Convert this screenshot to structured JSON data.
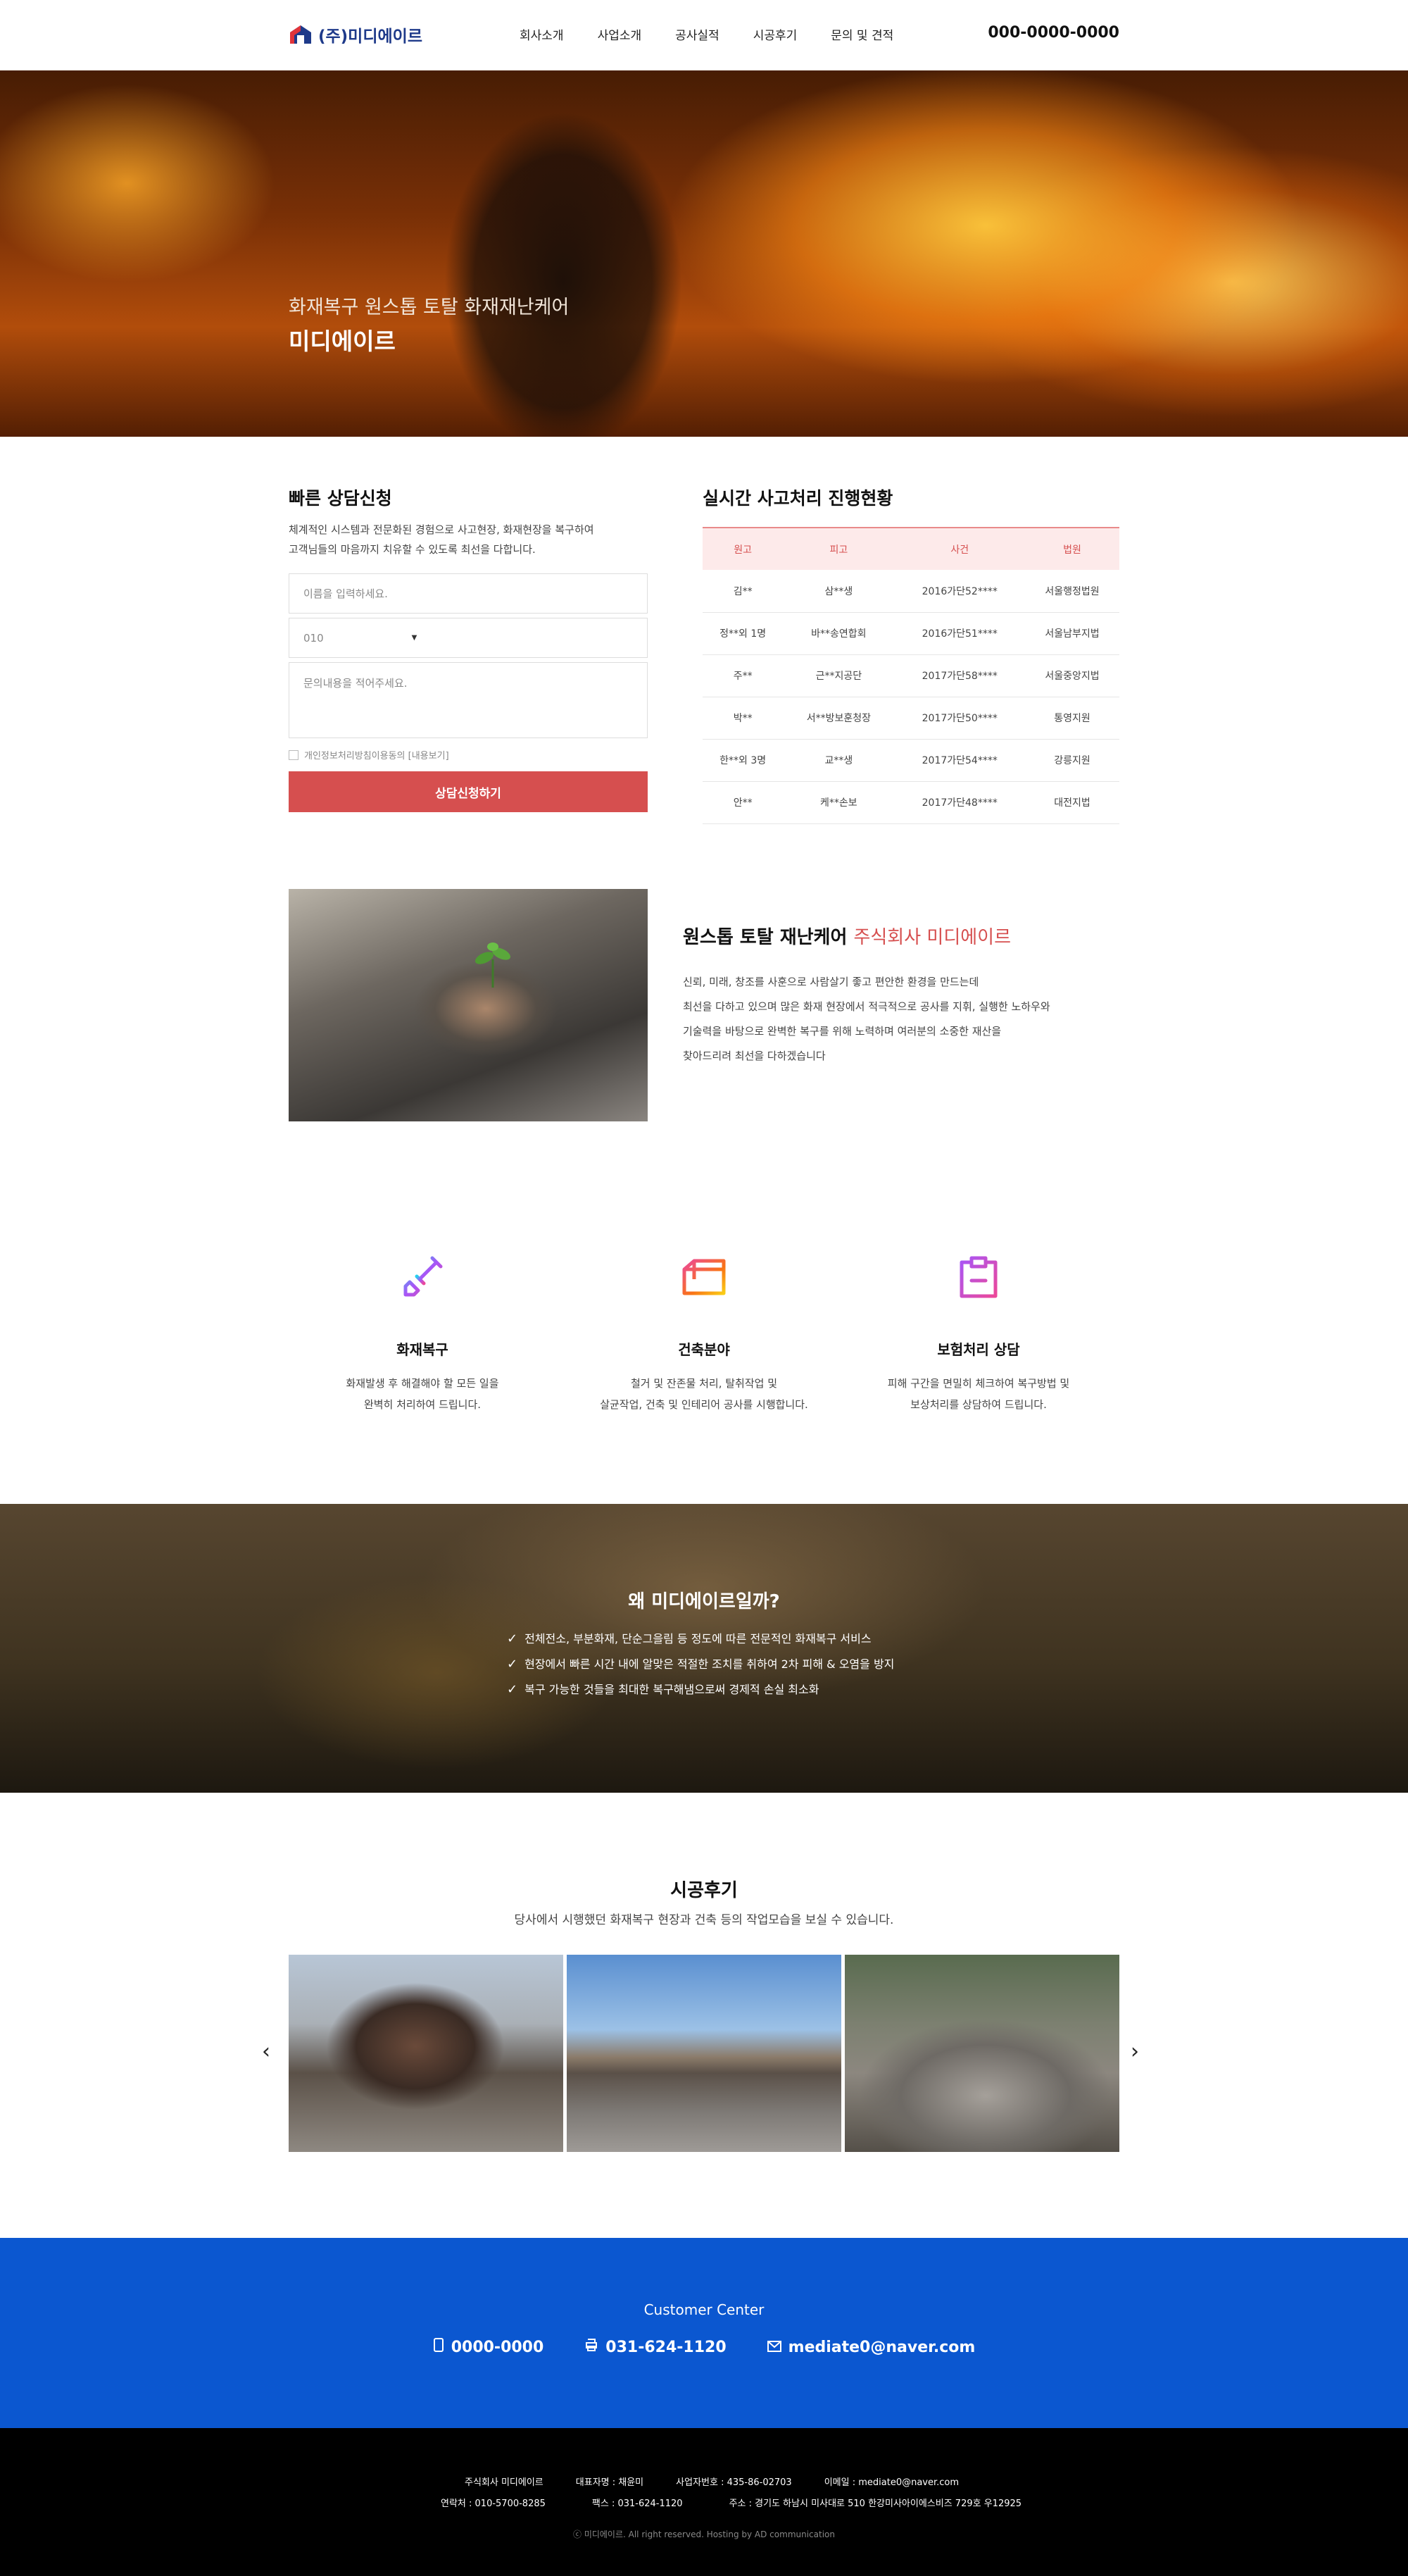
{
  "header": {
    "logo_text": "(주)미디에이르",
    "nav": [
      "회사소개",
      "사업소개",
      "공사실적",
      "시공후기",
      "문의 및 견적"
    ],
    "phone": "000-0000-0000"
  },
  "hero": {
    "subtitle": "화재복구 원스톱 토탈 화재재난케어",
    "title": "미디에이르"
  },
  "consult": {
    "title": "빠른 상담신청",
    "desc_line1": "체계적인 시스템과 전문화된 경험으로 사고현장, 화재현장을 복구하여",
    "desc_line2": "고객님들의 마음까지 치유할 수 있도록 최선을 다합니다.",
    "name_placeholder": "이름을 입력하세요.",
    "phone_prefix": "010",
    "message_placeholder": "문의내용을 적어주세요.",
    "agree_text": "개인정보처리방침이용동의 [내용보기]",
    "submit_label": "상담신청하기"
  },
  "status": {
    "title": "실시간 사고처리 진행현황",
    "columns": [
      "원고",
      "피고",
      "사건",
      "법원"
    ],
    "rows": [
      [
        "김**",
        "삼**생",
        "2016가단52****",
        "서울행정법원"
      ],
      [
        "정**외 1명",
        "바**송연합회",
        "2016가단51****",
        "서울남부지법"
      ],
      [
        "주**",
        "근**지공단",
        "2017가단58****",
        "서울중앙지법"
      ],
      [
        "박**",
        "서**방보훈청장",
        "2017가단50****",
        "통영지원"
      ],
      [
        "한**외 3명",
        "교**생",
        "2017가단54****",
        "강릉지원"
      ],
      [
        "안**",
        "케**손보",
        "2017가단48****",
        "대전지법"
      ]
    ]
  },
  "about": {
    "title_main": "원스톱 토탈 재난케어",
    "title_accent": "주식회사 미디에이르",
    "desc_lines": [
      "신뢰, 미래, 창조를 사훈으로 사람살기 좋고 편안한 환경을 만드는데",
      "최선을 다하고 있으며 많은 화재 현장에서 적극적으로 공사를 지휘, 실행한 노하우와",
      "기술력을 바탕으로 완벽한 복구를 위해 노력하며 여러분의 소중한 재산을",
      "찾아드리려 최선을 다하겠습니다"
    ]
  },
  "services": [
    {
      "title": "화재복구",
      "desc1": "화재발생 후 해결해야 할 모든 일을",
      "desc2": "완벽히 처리하여 드립니다.",
      "icon": "shovel-icon"
    },
    {
      "title": "건축분야",
      "desc1": "철거 및 잔존물 처리, 탈취작업 및",
      "desc2": "살균작업, 건축 및 인테리어 공사를 시행합니다.",
      "icon": "box-icon"
    },
    {
      "title": "보험처리 상담",
      "desc1": "피해 구간을 면밀히 체크하여 복구방법 및",
      "desc2": "보상처리를 상담하여 드립니다.",
      "icon": "clipboard-icon"
    }
  ],
  "why": {
    "title": "왜 미디에이르일까?",
    "items": [
      "전체전소, 부분화재, 단순그을림 등 정도에 따른 전문적인 화재복구 서비스",
      "현장에서 빠른 시간 내에 알맞은 적절한 조치를 취하여 2차 피해 & 오염을 방지",
      "복구 가능한 것들을 최대한 복구해냄으로써 경제적 손실 최소화"
    ]
  },
  "reviews": {
    "title": "시공후기",
    "desc": "당사에서 시행했던 화재복구 현장과 건축 등의 작업모습을 보실 수 있습니다."
  },
  "customer_center": {
    "label": "Customer Center",
    "phone": "0000-0000",
    "fax": "031-624-1120",
    "email": "mediate0@naver.com"
  },
  "footer": {
    "row1": [
      "주식회사 미디에이르",
      "대표자명 : 채윤미",
      "사업자번호 : 435-86-02703",
      "이메일 : mediate0@naver.com"
    ],
    "row2": [
      "연락처 : 010-5700-8285",
      "팩스 : 031-624-1120",
      "주소 : 경기도 하남시 미사대로 510 한강미사아이에스비즈 729호 우12925"
    ],
    "copyright": "ⓒ 미디에이르. All right reserved. Hosting by AD communication"
  },
  "colors": {
    "accent_red": "#d64f4f",
    "brand_blue": "#0b57d0",
    "logo_navy": "#1e3a8a"
  }
}
